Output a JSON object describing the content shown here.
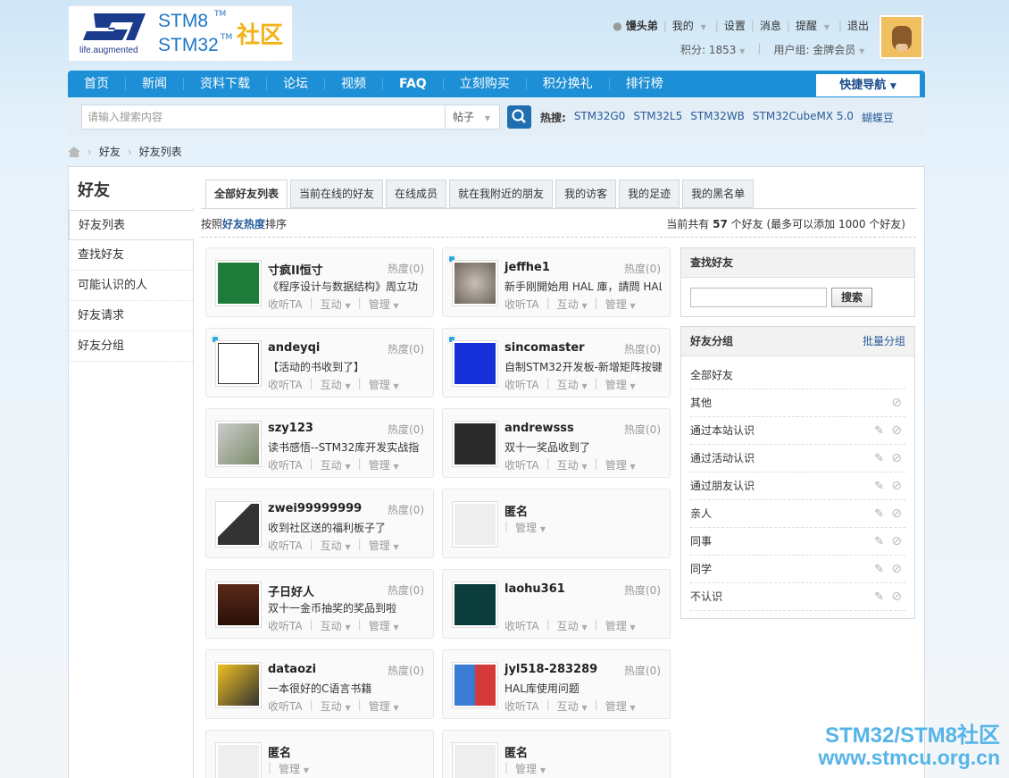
{
  "logo": {
    "tagline": "life.augmented",
    "line1": "STM8",
    "line2": "STM32",
    "tm": "TM",
    "community": "社区"
  },
  "header": {
    "username": "馒头弟",
    "my": "我的",
    "settings": "设置",
    "messages": "消息",
    "remind": "提醒",
    "logout": "退出",
    "points": "积分: 1853",
    "usergroup": "用户组: 金牌会员"
  },
  "nav": {
    "items": [
      "首页",
      "新闻",
      "资料下载",
      "论坛",
      "视频",
      "FAQ",
      "立刻购买",
      "积分换礼",
      "排行榜"
    ],
    "quick": "快捷导航"
  },
  "search": {
    "placeholder": "请输入搜索内容",
    "type": "帖子",
    "hot_label": "热搜:",
    "hot": [
      "STM32G0",
      "STM32L5",
      "STM32WB",
      "STM32CubeMX 5.0",
      "蝴蝶豆"
    ]
  },
  "breadcrumb": [
    "好友",
    "好友列表"
  ],
  "sidebar": {
    "title": "好友",
    "items": [
      "好友列表",
      "查找好友",
      "可能认识的人",
      "好友请求",
      "好友分组"
    ]
  },
  "tabs": [
    "全部好友列表",
    "当前在线的好友",
    "在线成员",
    "就在我附近的朋友",
    "我的访客",
    "我的足迹",
    "我的黑名单"
  ],
  "sort": {
    "prefix": "按照",
    "key": "好友热度",
    "suffix": "排序",
    "count_text_a": "当前共有 ",
    "count": "57",
    "count_text_b": " 个好友 (最多可以添加 1000 个好友)"
  },
  "friend_actions": {
    "listen": "收听TA",
    "interact": "互动",
    "manage": "管理",
    "anon": "匿名"
  },
  "friends": [
    {
      "name": "寸疯II恒寸",
      "heat": "热度(0)",
      "status": "《程序设计与数据结构》周立功",
      "online": false
    },
    {
      "name": "jeffhe1",
      "heat": "热度(0)",
      "status": "新手刚開始用 HAL 庫，請問 HAL",
      "online": true
    },
    {
      "name": "andeyqi",
      "heat": "热度(0)",
      "status": "【活动的书收到了】",
      "online": true
    },
    {
      "name": "sincomaster",
      "heat": "热度(0)",
      "status": "自制STM32开发板-新增矩阵按键",
      "online": true
    },
    {
      "name": "szy123",
      "heat": "热度(0)",
      "status": "读书感悟--STM32库开发实战指",
      "online": false
    },
    {
      "name": "andrewsss",
      "heat": "热度(0)",
      "status": "双十一奖品收到了",
      "online": false
    },
    {
      "name": "zwei99999999",
      "heat": "热度(0)",
      "status": "收到社区送的福利板子了",
      "online": false
    },
    {
      "name": "匿名",
      "heat": "",
      "status": "",
      "online": false
    },
    {
      "name": "子日好人",
      "heat": "热度(0)",
      "status": "双十一金币抽奖的奖品到啦",
      "online": false
    },
    {
      "name": "laohu361",
      "heat": "热度(0)",
      "status": "",
      "online": false
    },
    {
      "name": "dataozi",
      "heat": "热度(0)",
      "status": "一本很好的C语言书籍",
      "online": false
    },
    {
      "name": "jyl518-283289",
      "heat": "热度(0)",
      "status": "HAL库使用问题",
      "online": false
    },
    {
      "name": "匿名",
      "heat": "",
      "status": "",
      "online": false
    },
    {
      "name": "匿名",
      "heat": "",
      "status": "",
      "online": false
    }
  ],
  "find_panel": {
    "title": "查找好友",
    "button": "搜索"
  },
  "group_panel": {
    "title": "好友分组",
    "batch": "批量分组",
    "groups": [
      "全部好友",
      "其他",
      "通过本站认识",
      "通过活动认识",
      "通过朋友认识",
      "亲人",
      "同事",
      "同学",
      "不认识"
    ]
  },
  "watermark": {
    "line1": "STM32/STM8社区",
    "line2": "www.stmcu.org.cn"
  },
  "colors": {
    "nav": "#1d8fd6",
    "link": "#2a5c9a",
    "online": "#29a9e1"
  }
}
